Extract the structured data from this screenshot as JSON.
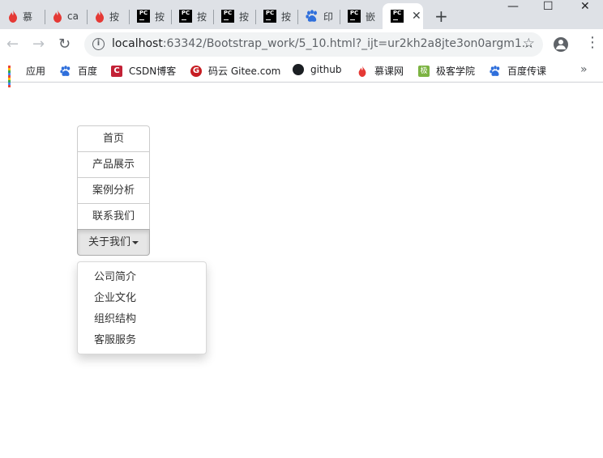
{
  "browser": {
    "tabs": [
      {
        "label": "慕",
        "icon": "flame-icon"
      },
      {
        "label": "ca",
        "icon": "flame-icon"
      },
      {
        "label": "按",
        "icon": "flame-icon"
      },
      {
        "label": "按",
        "icon": "pycharm-icon"
      },
      {
        "label": "按",
        "icon": "pycharm-icon"
      },
      {
        "label": "按",
        "icon": "pycharm-icon"
      },
      {
        "label": "按",
        "icon": "pycharm-icon"
      },
      {
        "label": "印",
        "icon": "baidu-paw-icon"
      },
      {
        "label": "嵌",
        "icon": "pycharm-icon"
      },
      {
        "label": "",
        "icon": "pycharm-icon",
        "active": true
      }
    ],
    "pc_glyph": "PC",
    "close_glyph": "✕",
    "new_tab_glyph": "+",
    "window_controls": {
      "minimize": "—",
      "maximize": "☐",
      "close": "✕"
    },
    "nav": {
      "back": "←",
      "forward": "→",
      "reload": "↻"
    },
    "address": {
      "info_glyph": "i",
      "host": "localhost",
      "rest": ":63342/Bootstrap_work/5_10.html?_ijt=ur2kh2a8jte3on0argm1...",
      "star_glyph": "☆"
    },
    "menu_glyph": "⋮",
    "bookmarks": [
      {
        "label": "应用",
        "icon": "apps-grid-icon"
      },
      {
        "label": "百度",
        "icon": "baidu-paw-icon"
      },
      {
        "label": "CSDN博客",
        "icon": "csdn-icon",
        "glyph": "C"
      },
      {
        "label": "码云 Gitee.com",
        "icon": "gitee-icon",
        "glyph": "G"
      },
      {
        "label": "github",
        "icon": "github-icon"
      },
      {
        "label": "慕课网",
        "icon": "flame-icon"
      },
      {
        "label": "极客学院",
        "icon": "geek-icon",
        "glyph": "极"
      },
      {
        "label": "百度传课",
        "icon": "baidu-paw-icon"
      }
    ],
    "bookmarks_more": "»",
    "colors": {
      "flame": "#e53935",
      "baidu": "#2f6fdb",
      "apps": [
        "#ea4335",
        "#fbbc05",
        "#34a853",
        "#4285f4"
      ]
    }
  },
  "page": {
    "nav_items": [
      "首页",
      "产品展示",
      "案例分析",
      "联系我们"
    ],
    "dropdown_label": "关于我们",
    "dropdown_items": [
      "公司简介",
      "企业文化",
      "组织结构",
      "客服服务"
    ]
  }
}
